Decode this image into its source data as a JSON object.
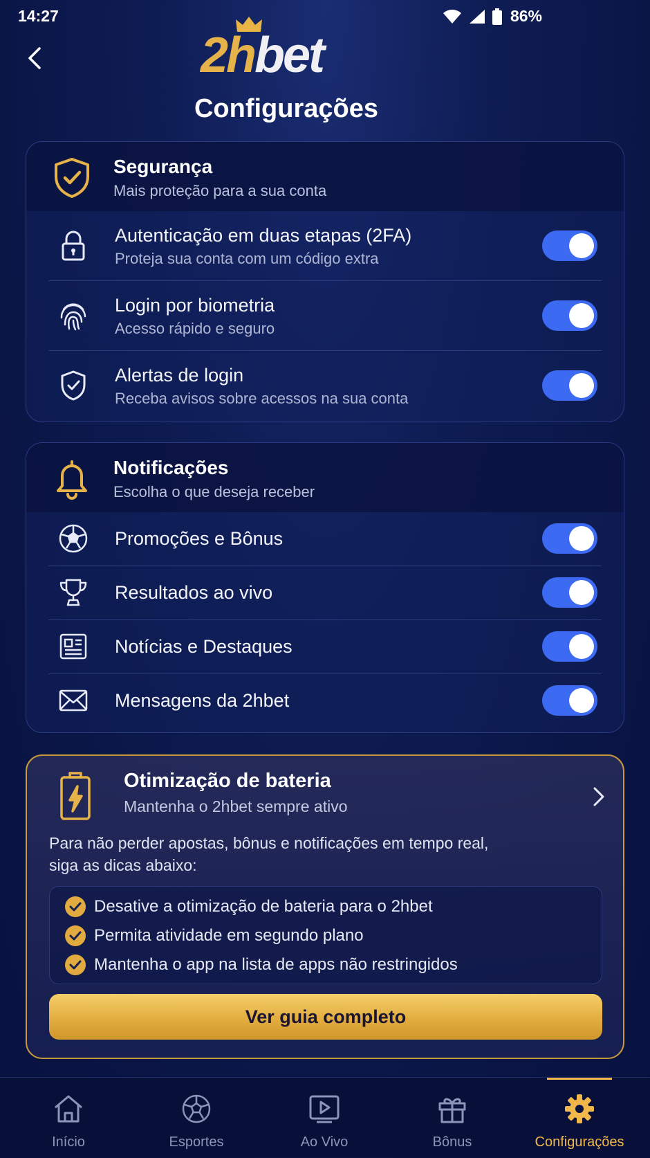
{
  "status_bar": {
    "time": "14:27",
    "battery": "86%"
  },
  "header": {
    "logo_part1": "2h",
    "logo_part2": "bet",
    "title": "Configurações"
  },
  "security": {
    "title": "Segurança",
    "subtitle": "Mais proteção para a sua conta",
    "items": [
      {
        "title": "Autenticação em duas etapas (2FA)",
        "subtitle": "Proteja sua conta com um código extra",
        "enabled": true,
        "icon": "lock-icon"
      },
      {
        "title": "Login por biometria",
        "subtitle": "Acesso rápido e seguro",
        "enabled": true,
        "icon": "fingerprint-icon"
      },
      {
        "title": "Alertas de login",
        "subtitle": "Receba avisos sobre acessos na sua conta",
        "enabled": true,
        "icon": "shield-check-icon"
      }
    ]
  },
  "notifications": {
    "title": "Notificações",
    "subtitle": "Escolha o que deseja receber",
    "items": [
      {
        "title": "Promoções e Bônus",
        "enabled": true,
        "icon": "soccer-ball-icon"
      },
      {
        "title": "Resultados ao vivo",
        "enabled": true,
        "icon": "trophy-icon"
      },
      {
        "title": "Notícias e Destaques",
        "enabled": true,
        "icon": "newspaper-icon"
      },
      {
        "title": "Mensagens da 2hbet",
        "enabled": true,
        "icon": "envelope-icon"
      }
    ]
  },
  "battery": {
    "title": "Otimização de bateria",
    "subtitle": "Mantenha o 2hbet sempre ativo",
    "description_line1": "Para não perder apostas, bônus e notificações em tempo real,",
    "description_line2": "siga as dicas abaixo:",
    "tips": [
      "Desative a otimização de bateria para o 2hbet",
      "Permita atividade em segundo plano",
      "Mantenha o app na lista de apps não restringidos"
    ],
    "button_label": "Ver guia completo"
  },
  "bottom_nav": {
    "items": [
      {
        "label": "Início",
        "icon": "home-icon"
      },
      {
        "label": "Esportes",
        "icon": "soccer-ball-icon"
      },
      {
        "label": "Ao Vivo",
        "icon": "play-screen-icon"
      },
      {
        "label": "Bônus",
        "icon": "gift-icon"
      },
      {
        "label": "Configurações",
        "icon": "gear-icon",
        "active": true
      }
    ]
  },
  "colors": {
    "accent_blue": "#3d6af2",
    "gold": "#e6b34a",
    "background": "#0f1d55"
  }
}
